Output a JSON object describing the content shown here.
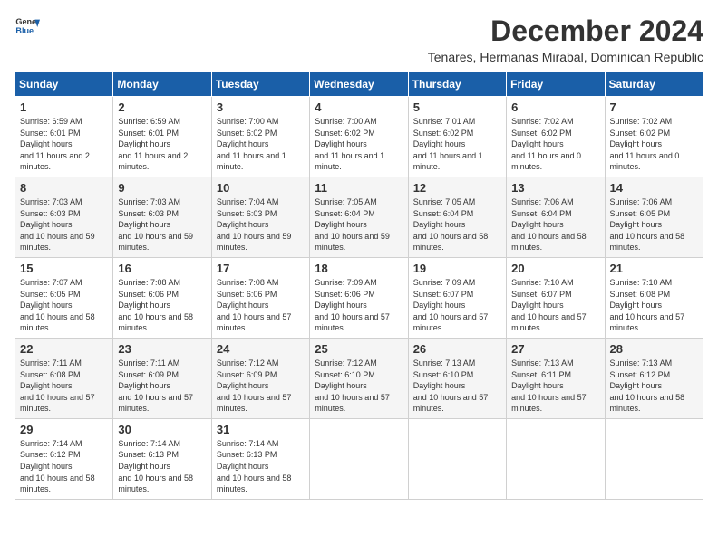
{
  "logo": {
    "line1": "General",
    "line2": "Blue"
  },
  "title": "December 2024",
  "location": "Tenares, Hermanas Mirabal, Dominican Republic",
  "weekdays": [
    "Sunday",
    "Monday",
    "Tuesday",
    "Wednesday",
    "Thursday",
    "Friday",
    "Saturday"
  ],
  "weeks": [
    [
      {
        "day": "1",
        "sunrise": "6:59 AM",
        "sunset": "6:01 PM",
        "daylight": "11 hours and 2 minutes."
      },
      {
        "day": "2",
        "sunrise": "6:59 AM",
        "sunset": "6:01 PM",
        "daylight": "11 hours and 2 minutes."
      },
      {
        "day": "3",
        "sunrise": "7:00 AM",
        "sunset": "6:02 PM",
        "daylight": "11 hours and 1 minute."
      },
      {
        "day": "4",
        "sunrise": "7:00 AM",
        "sunset": "6:02 PM",
        "daylight": "11 hours and 1 minute."
      },
      {
        "day": "5",
        "sunrise": "7:01 AM",
        "sunset": "6:02 PM",
        "daylight": "11 hours and 1 minute."
      },
      {
        "day": "6",
        "sunrise": "7:02 AM",
        "sunset": "6:02 PM",
        "daylight": "11 hours and 0 minutes."
      },
      {
        "day": "7",
        "sunrise": "7:02 AM",
        "sunset": "6:02 PM",
        "daylight": "11 hours and 0 minutes."
      }
    ],
    [
      {
        "day": "8",
        "sunrise": "7:03 AM",
        "sunset": "6:03 PM",
        "daylight": "10 hours and 59 minutes."
      },
      {
        "day": "9",
        "sunrise": "7:03 AM",
        "sunset": "6:03 PM",
        "daylight": "10 hours and 59 minutes."
      },
      {
        "day": "10",
        "sunrise": "7:04 AM",
        "sunset": "6:03 PM",
        "daylight": "10 hours and 59 minutes."
      },
      {
        "day": "11",
        "sunrise": "7:05 AM",
        "sunset": "6:04 PM",
        "daylight": "10 hours and 59 minutes."
      },
      {
        "day": "12",
        "sunrise": "7:05 AM",
        "sunset": "6:04 PM",
        "daylight": "10 hours and 58 minutes."
      },
      {
        "day": "13",
        "sunrise": "7:06 AM",
        "sunset": "6:04 PM",
        "daylight": "10 hours and 58 minutes."
      },
      {
        "day": "14",
        "sunrise": "7:06 AM",
        "sunset": "6:05 PM",
        "daylight": "10 hours and 58 minutes."
      }
    ],
    [
      {
        "day": "15",
        "sunrise": "7:07 AM",
        "sunset": "6:05 PM",
        "daylight": "10 hours and 58 minutes."
      },
      {
        "day": "16",
        "sunrise": "7:08 AM",
        "sunset": "6:06 PM",
        "daylight": "10 hours and 58 minutes."
      },
      {
        "day": "17",
        "sunrise": "7:08 AM",
        "sunset": "6:06 PM",
        "daylight": "10 hours and 57 minutes."
      },
      {
        "day": "18",
        "sunrise": "7:09 AM",
        "sunset": "6:06 PM",
        "daylight": "10 hours and 57 minutes."
      },
      {
        "day": "19",
        "sunrise": "7:09 AM",
        "sunset": "6:07 PM",
        "daylight": "10 hours and 57 minutes."
      },
      {
        "day": "20",
        "sunrise": "7:10 AM",
        "sunset": "6:07 PM",
        "daylight": "10 hours and 57 minutes."
      },
      {
        "day": "21",
        "sunrise": "7:10 AM",
        "sunset": "6:08 PM",
        "daylight": "10 hours and 57 minutes."
      }
    ],
    [
      {
        "day": "22",
        "sunrise": "7:11 AM",
        "sunset": "6:08 PM",
        "daylight": "10 hours and 57 minutes."
      },
      {
        "day": "23",
        "sunrise": "7:11 AM",
        "sunset": "6:09 PM",
        "daylight": "10 hours and 57 minutes."
      },
      {
        "day": "24",
        "sunrise": "7:12 AM",
        "sunset": "6:09 PM",
        "daylight": "10 hours and 57 minutes."
      },
      {
        "day": "25",
        "sunrise": "7:12 AM",
        "sunset": "6:10 PM",
        "daylight": "10 hours and 57 minutes."
      },
      {
        "day": "26",
        "sunrise": "7:13 AM",
        "sunset": "6:10 PM",
        "daylight": "10 hours and 57 minutes."
      },
      {
        "day": "27",
        "sunrise": "7:13 AM",
        "sunset": "6:11 PM",
        "daylight": "10 hours and 57 minutes."
      },
      {
        "day": "28",
        "sunrise": "7:13 AM",
        "sunset": "6:12 PM",
        "daylight": "10 hours and 58 minutes."
      }
    ],
    [
      {
        "day": "29",
        "sunrise": "7:14 AM",
        "sunset": "6:12 PM",
        "daylight": "10 hours and 58 minutes."
      },
      {
        "day": "30",
        "sunrise": "7:14 AM",
        "sunset": "6:13 PM",
        "daylight": "10 hours and 58 minutes."
      },
      {
        "day": "31",
        "sunrise": "7:14 AM",
        "sunset": "6:13 PM",
        "daylight": "10 hours and 58 minutes."
      },
      null,
      null,
      null,
      null
    ]
  ]
}
